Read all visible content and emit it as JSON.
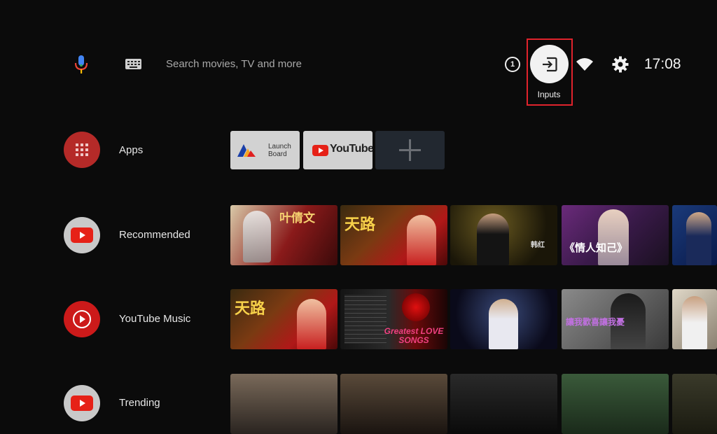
{
  "search": {
    "placeholder": "Search movies, TV and more"
  },
  "topbar": {
    "notification_count": "1",
    "inputs_label": "Inputs",
    "time": "17:08"
  },
  "rows": {
    "apps": {
      "label": "Apps",
      "tiles": {
        "launch_board": "Launch\nBoard",
        "youtube": "YouTube"
      }
    },
    "recommended": {
      "label": "Recommended",
      "tiles": [
        {
          "caption": "叶倩文"
        },
        {
          "caption": "天路"
        },
        {
          "caption": "韩红"
        },
        {
          "caption": "《情人知己》"
        },
        {
          "caption": ""
        }
      ]
    },
    "youtube_music": {
      "label": "YouTube Music",
      "tiles": [
        {
          "caption": "天路"
        },
        {
          "caption": "Greatest LOVE SONGS"
        },
        {
          "caption": ""
        },
        {
          "caption": "讓我歡喜讓我憂"
        },
        {
          "caption": ""
        }
      ]
    },
    "trending": {
      "label": "Trending"
    }
  },
  "colors": {
    "accent_red": "#d32f2f",
    "highlight_red": "#e0232c",
    "background": "#0b0b0b"
  }
}
